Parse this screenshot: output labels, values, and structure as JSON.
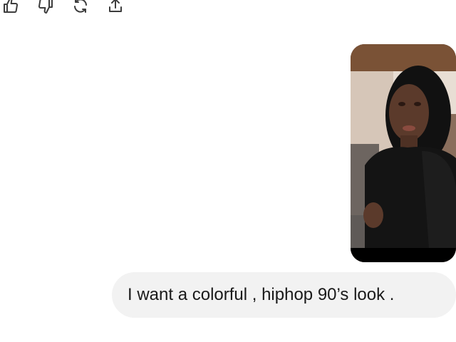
{
  "actions": {
    "like": {
      "icon": "thumbs-up-icon"
    },
    "dislike": {
      "icon": "thumbs-down-icon"
    },
    "regenerate": {
      "icon": "regenerate-icon"
    },
    "share": {
      "icon": "share-icon"
    }
  },
  "conversation": {
    "attachment": {
      "kind": "photo",
      "icon": "image-attachment"
    },
    "user_message": "I want a colorful , hiphop 90’s look ."
  },
  "colors": {
    "bubble_background": "#f2f2f2",
    "text": "#1a1a1a",
    "icon_stroke": "#3d3d3d"
  }
}
